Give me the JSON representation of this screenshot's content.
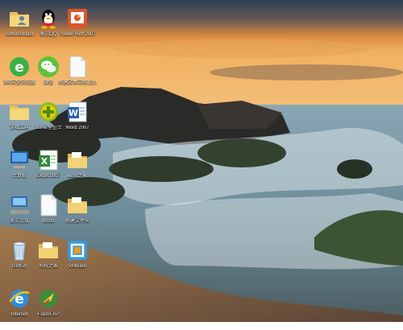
{
  "desktop": {
    "icons": [
      {
        "id": "folder-user",
        "kind": "folder-user",
        "label": "Administrator"
      },
      {
        "id": "qq",
        "kind": "qq",
        "label": "腾讯QQ"
      },
      {
        "id": "powerpoint",
        "kind": "ppt",
        "label": "PowerPoint 2007"
      },
      {
        "id": "browser-360",
        "kind": "ie-green",
        "label": "360安全浏览器"
      },
      {
        "id": "wechat",
        "kind": "wechat",
        "label": "微信"
      },
      {
        "id": "new-text",
        "kind": "doc-blank",
        "label": "新建文本文档 (2).txt"
      },
      {
        "id": "tools-folder",
        "kind": "folder",
        "label": "游戏工具"
      },
      {
        "id": "guard-360",
        "kind": "guard",
        "label": "360安全卫士"
      },
      {
        "id": "word",
        "kind": "word",
        "label": "Word 2007"
      },
      {
        "id": "computer",
        "kind": "computer",
        "label": "计算机"
      },
      {
        "id": "excel",
        "kind": "excel",
        "label": "Excel 2007"
      },
      {
        "id": "win8-folder",
        "kind": "folder-doc",
        "label": "win8之家"
      },
      {
        "id": "network",
        "kind": "network",
        "label": "宽带连接"
      },
      {
        "id": "hosts",
        "kind": "doc-blank",
        "label": "hosts"
      },
      {
        "id": "new-folder",
        "kind": "folder-doc",
        "label": "新建文件夹"
      },
      {
        "id": "recycle-bin",
        "kind": "recycle",
        "label": "回收站"
      },
      {
        "id": "sys-folder",
        "kind": "folder-doc",
        "label": "系统之家"
      },
      {
        "id": "vmware",
        "kind": "vmware",
        "label": "VMware"
      },
      {
        "id": "ie",
        "kind": "ie",
        "label": "Internet"
      },
      {
        "id": "flashfxp",
        "kind": "flashfxp",
        "label": "FlashFXP"
      }
    ]
  }
}
